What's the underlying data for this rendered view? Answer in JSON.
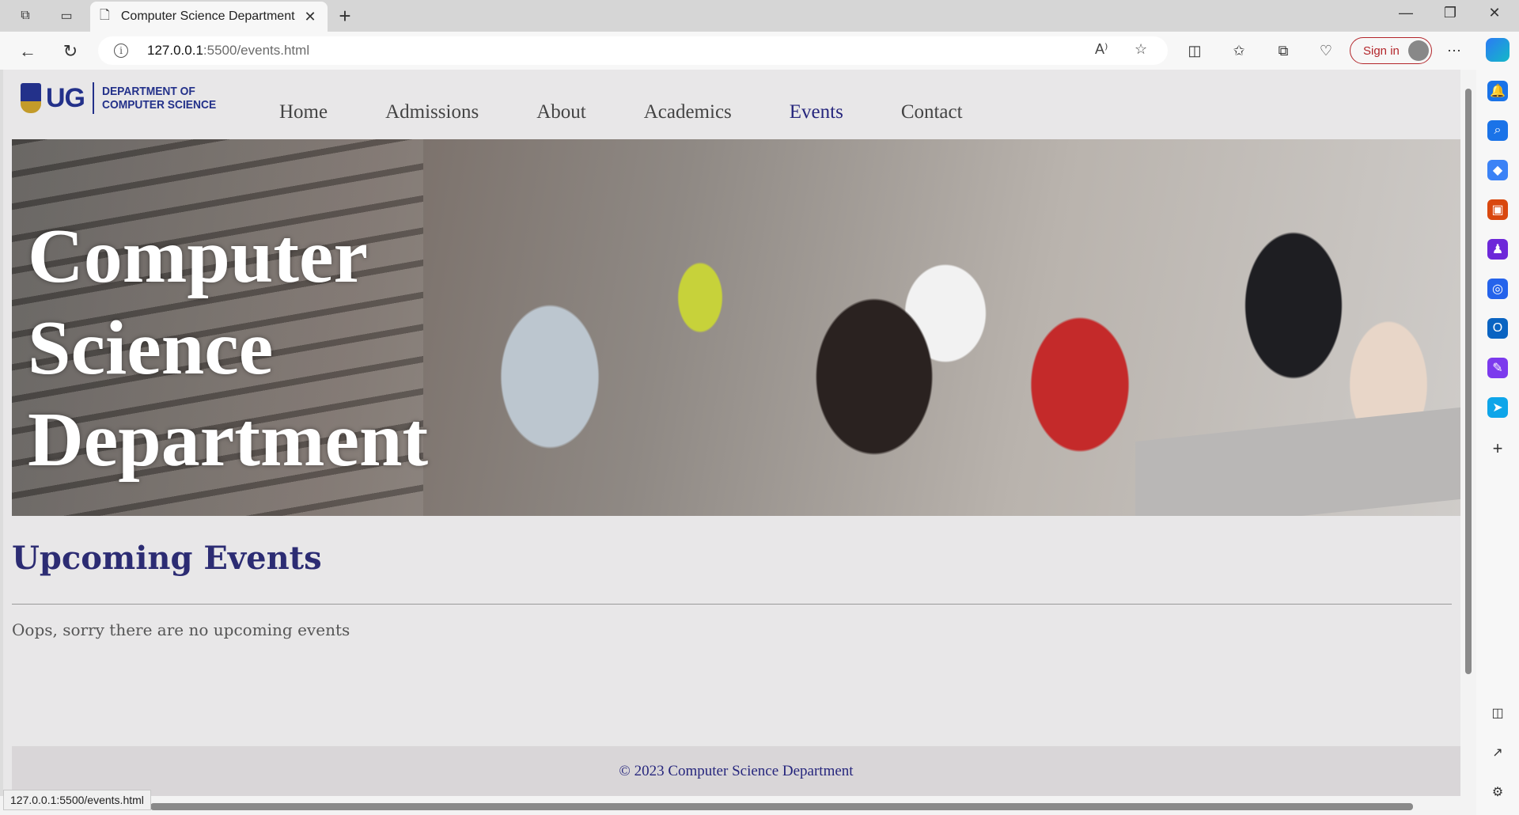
{
  "browser": {
    "tab_title": "Computer Science Department",
    "url_host": "127.0.0.1",
    "url_path": ":5500/events.html",
    "signin_label": "Sign in",
    "status_url": "127.0.0.1:5500/events.html"
  },
  "site": {
    "logo_ug": "UG",
    "logo_line1": "DEPARTMENT OF",
    "logo_line2": "COMPUTER SCIENCE",
    "nav": [
      "Home",
      "Admissions",
      "About",
      "Academics",
      "Events",
      "Contact"
    ],
    "active_nav": "Events",
    "hero_title_line1": "Computer",
    "hero_title_line2": "Science",
    "hero_title_line3": "Department",
    "events_heading": "Upcoming Events",
    "events_message": "Oops, sorry there are no upcoming events",
    "footer": "© 2023 Computer Science Department"
  },
  "colors": {
    "brand_navy": "#23318a",
    "nav_active": "#26267d",
    "signin_red": "#b3262b"
  }
}
